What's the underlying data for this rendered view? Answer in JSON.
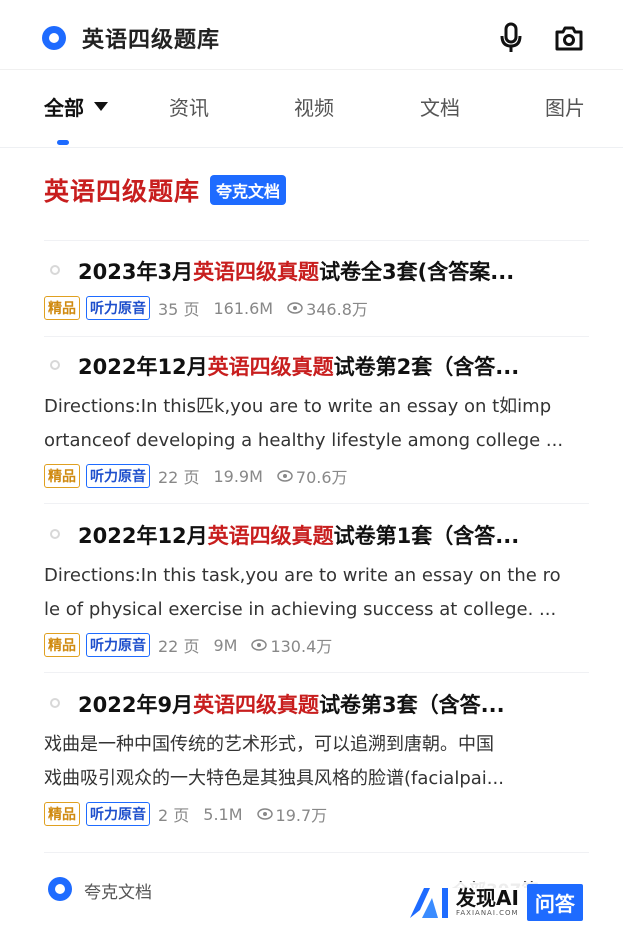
{
  "search": {
    "query": "英语四级题库"
  },
  "tabs": [
    {
      "label": "全部"
    },
    {
      "label": "资讯"
    },
    {
      "label": "视频"
    },
    {
      "label": "文档"
    },
    {
      "label": "图片"
    }
  ],
  "header": {
    "title": "英语四级题库",
    "badge": "夸克文档"
  },
  "items": [
    {
      "title_pre": "2023年3月",
      "title_hl": "英语四级真题",
      "title_post": "试卷全3套(含答案...",
      "desc_lines": [],
      "tag_premium": "精品",
      "tag_audio": "听力原音",
      "pages": "35 页",
      "size": "161.6M",
      "views": "346.8万"
    },
    {
      "title_pre": "2022年12月",
      "title_hl": "英语四级真题",
      "title_post": "试卷第2套（含答...",
      "desc_lines": [
        "Directions:In this匹k,you are to write an essay on t如imp",
        "ortanceof developing a healthy lifestyle among college ..."
      ],
      "tag_premium": "精品",
      "tag_audio": "听力原音",
      "pages": "22 页",
      "size": "19.9M",
      "views": "70.6万"
    },
    {
      "title_pre": "2022年12月",
      "title_hl": "英语四级真题",
      "title_post": "试卷第1套（含答...",
      "desc_lines": [
        "Directions:In this task,you are to write an essay on the ro",
        "le of physical exercise in achieving success at college. ..."
      ],
      "tag_premium": "精品",
      "tag_audio": "听力原音",
      "pages": "22 页",
      "size": "9M",
      "views": "130.4万"
    },
    {
      "title_pre": "2022年9月",
      "title_hl": "英语四级真题",
      "title_post": "试卷第3套（含答...",
      "desc_lines": [
        "戏曲是一种中国传统的艺术形式，可以追溯到唐朝。中国",
        "戏曲吸引观众的一大特色是其独具风格的脸谱(facialpai..."
      ],
      "tag_premium": "精品",
      "tag_audio": "听力原音",
      "pages": "2 页",
      "size": "5.1M",
      "views": "19.7万"
    }
  ],
  "footer": {
    "source": "夸克文档",
    "total": "全部397篇"
  },
  "watermark": {
    "name": "发现AI",
    "sub": "FAXIANAI.COM",
    "qa": "问答"
  },
  "colors": {
    "accent": "#1e6bff",
    "highlight": "#c81e1e",
    "premium": "#e0a020"
  }
}
